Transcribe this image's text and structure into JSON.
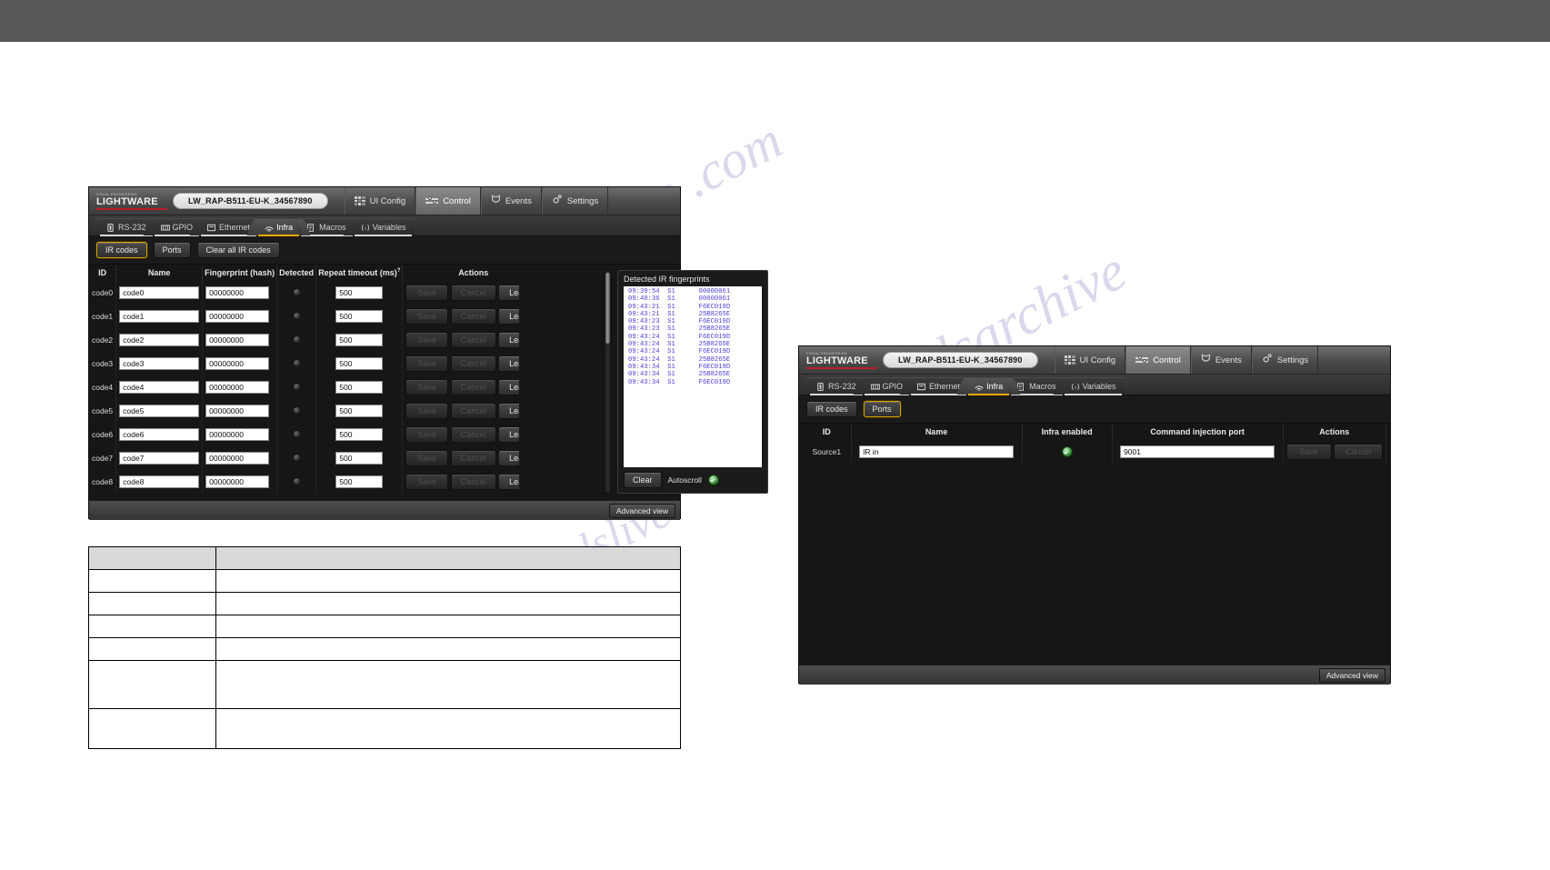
{
  "app": {
    "brand_top": "VISUAL ENGINEERING",
    "brand_name": "LIGHTWARE",
    "device_name": "LW_RAP-B511-EU-K_34567890",
    "menu": [
      {
        "label": "UI Config",
        "icon": "grid-icon",
        "active": false
      },
      {
        "label": "Control",
        "icon": "sliders-icon",
        "active": true
      },
      {
        "label": "Events",
        "icon": "shield-icon",
        "active": false
      },
      {
        "label": "Settings",
        "icon": "gear-icon",
        "active": false
      }
    ],
    "tabs": [
      {
        "label": "RS-232",
        "icon": "serial-port-icon",
        "active": false
      },
      {
        "label": "GPIO",
        "icon": "gpio-icon",
        "active": false
      },
      {
        "label": "Ethernet",
        "icon": "ethernet-icon",
        "active": false
      },
      {
        "label": "Infra",
        "icon": "infrared-wave-icon",
        "active": true
      },
      {
        "label": "Macros",
        "icon": "macros-icon",
        "active": false
      },
      {
        "label": "Variables",
        "icon": "variables-icon",
        "active": false
      }
    ],
    "advanced_view_label": "Advanced view",
    "accent_color": "#e8a80c",
    "brand_rule_color": "#b81f28",
    "log_text_color": "#4b3fd0"
  },
  "window_top": {
    "subbar": [
      {
        "label": "IR codes",
        "selected": true
      },
      {
        "label": "Ports",
        "selected": false
      },
      {
        "label": "Clear all IR codes",
        "selected": false
      }
    ],
    "table": {
      "headers": [
        "ID",
        "Name",
        "Fingerprint (hash)",
        "Detected",
        "Repeat timeout (ms)",
        "Actions"
      ],
      "repeat_timeout_superscript": "?",
      "action_labels": {
        "save": "Save",
        "cancel": "Cancel",
        "learn": "Learn"
      },
      "rows": [
        {
          "id": "code0",
          "name": "code0",
          "fingerprint": "00000000",
          "detected": false,
          "repeat_timeout": "500"
        },
        {
          "id": "code1",
          "name": "code1",
          "fingerprint": "00000000",
          "detected": false,
          "repeat_timeout": "500"
        },
        {
          "id": "code2",
          "name": "code2",
          "fingerprint": "00000000",
          "detected": false,
          "repeat_timeout": "500"
        },
        {
          "id": "code3",
          "name": "code3",
          "fingerprint": "00000000",
          "detected": false,
          "repeat_timeout": "500"
        },
        {
          "id": "code4",
          "name": "code4",
          "fingerprint": "00000000",
          "detected": false,
          "repeat_timeout": "500"
        },
        {
          "id": "code5",
          "name": "code5",
          "fingerprint": "00000000",
          "detected": false,
          "repeat_timeout": "500"
        },
        {
          "id": "code6",
          "name": "code6",
          "fingerprint": "00000000",
          "detected": false,
          "repeat_timeout": "500"
        },
        {
          "id": "code7",
          "name": "code7",
          "fingerprint": "00000000",
          "detected": false,
          "repeat_timeout": "500"
        },
        {
          "id": "code8",
          "name": "code8",
          "fingerprint": "00000000",
          "detected": false,
          "repeat_timeout": "500"
        }
      ]
    },
    "log": {
      "title": "Detected IR fingerprints",
      "lines": [
        {
          "time": "09:39:54",
          "port": "S1",
          "code": "00000061"
        },
        {
          "time": "09:40:36",
          "port": "S1",
          "code": "00000061"
        },
        {
          "time": "09:43:21",
          "port": "S1",
          "code": "F6EC019D"
        },
        {
          "time": "09:43:21",
          "port": "S1",
          "code": "25B8265E"
        },
        {
          "time": "09:43:23",
          "port": "S1",
          "code": "F6EC019D"
        },
        {
          "time": "09:43:23",
          "port": "S1",
          "code": "25B8265E"
        },
        {
          "time": "09:43:24",
          "port": "S1",
          "code": "F6EC019D"
        },
        {
          "time": "09:43:24",
          "port": "S1",
          "code": "25B8265E"
        },
        {
          "time": "09:43:24",
          "port": "S1",
          "code": "F6EC019D"
        },
        {
          "time": "09:43:24",
          "port": "S1",
          "code": "25B8265E"
        },
        {
          "time": "09:43:34",
          "port": "S1",
          "code": "F6EC019D"
        },
        {
          "time": "09:43:34",
          "port": "S1",
          "code": "25B8265E"
        },
        {
          "time": "09:43:34",
          "port": "S1",
          "code": "F6EC019D"
        }
      ],
      "clear_label": "Clear",
      "autoscroll_label": "Autoscroll",
      "autoscroll_checked": true
    }
  },
  "window_bottom": {
    "subbar": [
      {
        "label": "IR codes",
        "selected": false
      },
      {
        "label": "Ports",
        "selected": true
      }
    ],
    "table": {
      "headers": [
        "ID",
        "Name",
        "Infra enabled",
        "Command injection port",
        "Actions"
      ],
      "action_labels": {
        "save": "Save",
        "cancel": "Cancel"
      },
      "rows": [
        {
          "id": "Source1",
          "name": "IR in",
          "infra_enabled": true,
          "port": "9001"
        }
      ]
    }
  },
  "watermarks": {
    "line1": "manualsive .com",
    "line2": "manualslive",
    "line3": "manualsarchive"
  }
}
